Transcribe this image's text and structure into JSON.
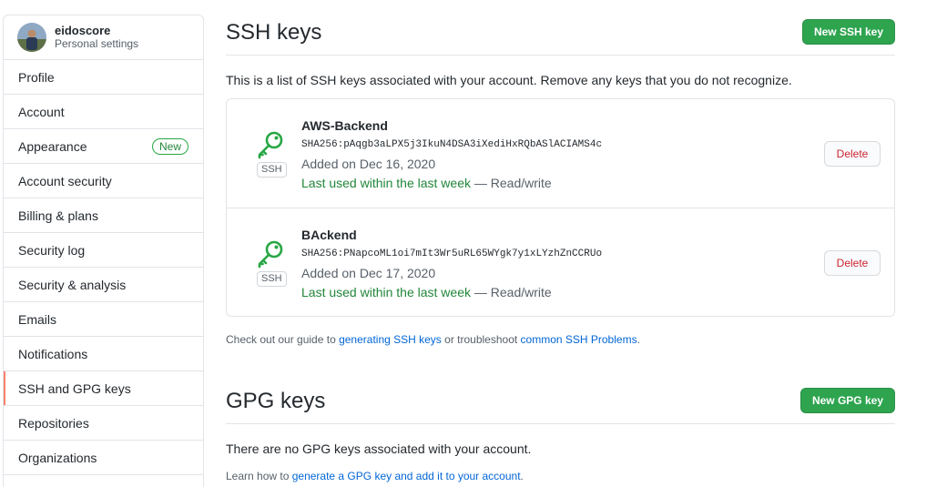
{
  "user": {
    "name": "eidoscore",
    "subtitle": "Personal settings"
  },
  "sidebar": {
    "items": [
      {
        "label": "Profile"
      },
      {
        "label": "Account"
      },
      {
        "label": "Appearance",
        "badge": "New"
      },
      {
        "label": "Account security"
      },
      {
        "label": "Billing & plans"
      },
      {
        "label": "Security log"
      },
      {
        "label": "Security & analysis"
      },
      {
        "label": "Emails"
      },
      {
        "label": "Notifications"
      },
      {
        "label": "SSH and GPG keys",
        "selected": true
      },
      {
        "label": "Repositories"
      },
      {
        "label": "Organizations"
      }
    ]
  },
  "ssh": {
    "title": "SSH keys",
    "new_button": "New SSH key",
    "description": "This is a list of SSH keys associated with your account. Remove any keys that you do not recognize.",
    "keys": [
      {
        "title": "AWS-Backend",
        "fingerprint": "SHA256:pAqgb3aLPX5j3IkuN4DSA3iXediHxRQbASlACIAMS4c",
        "added": "Added on Dec 16, 2020",
        "last_used": "Last used within the last week",
        "access": " — Read/write",
        "type_label": "SSH",
        "delete_label": "Delete"
      },
      {
        "title": "BAckend",
        "fingerprint": "SHA256:PNapcoML1oi7mIt3Wr5uRL65WYgk7y1xLYzhZnCCRUo",
        "added": "Added on Dec 17, 2020",
        "last_used": "Last used within the last week",
        "access": " — Read/write",
        "type_label": "SSH",
        "delete_label": "Delete"
      }
    ],
    "note": {
      "prefix": "Check out our guide to ",
      "link1": "generating SSH keys",
      "middle": " or troubleshoot ",
      "link2": "common SSH Problems",
      "suffix": "."
    }
  },
  "gpg": {
    "title": "GPG keys",
    "new_button": "New GPG key",
    "empty_text": "There are no GPG keys associated with your account.",
    "note": {
      "prefix": "Learn how to ",
      "link": "generate a GPG key and add it to your account",
      "suffix": "."
    }
  },
  "colors": {
    "green_button": "#2ea44f",
    "key_icon": "#28a745",
    "recent_text": "#22863a",
    "delete_text": "#cb2431",
    "link": "#0366d6",
    "selected_marker": "#f9826c"
  }
}
